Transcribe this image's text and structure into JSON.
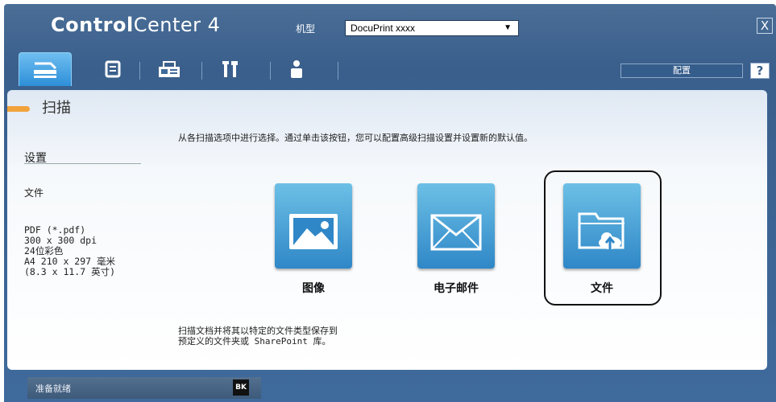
{
  "window": {
    "title_bold": "Control",
    "title_light": "Center 4",
    "model_label": "机型",
    "model_value": "DocuPrint xxxx",
    "close_glyph": "X"
  },
  "tabs": [
    {
      "name": "scan",
      "icon": "scanner-icon",
      "active": true
    },
    {
      "name": "pc-fax",
      "icon": "document-icon",
      "active": false
    },
    {
      "name": "fax",
      "icon": "fax-icon",
      "active": false
    },
    {
      "name": "device-settings",
      "icon": "tools-icon",
      "active": false
    },
    {
      "name": "support",
      "icon": "person-icon",
      "active": false
    }
  ],
  "toolbar": {
    "config_label": "配置",
    "help_label": "?"
  },
  "section": {
    "title": "扫描"
  },
  "main": {
    "instruction": "从各扫描选项中进行选择。通过单击该按钮，您可以配置高级扫描设置并设置新的默认值。",
    "description_lines": [
      "扫描文档并将其以特定的文件类型保存到",
      "预定义的文件夹或 SharePoint 库。"
    ]
  },
  "settings": {
    "label": "设置",
    "scan_type": "文件",
    "details": [
      "PDF (*.pdf)",
      "300 x 300 dpi",
      "24位彩色",
      "A4 210 x 297 毫米",
      "(8.3 x 11.7 英寸)"
    ]
  },
  "scan_buttons": [
    {
      "label": "图像",
      "icon": "image-icon",
      "selected": false
    },
    {
      "label": "电子邮件",
      "icon": "email-icon",
      "selected": false
    },
    {
      "label": "文件",
      "icon": "folder-upload-icon",
      "selected": true
    }
  ],
  "status": {
    "text": "准备就绪",
    "toner": "BK"
  },
  "colors": {
    "accent": "#f2a33c",
    "window": "#3f6a9c",
    "button": "#2f87c7"
  }
}
